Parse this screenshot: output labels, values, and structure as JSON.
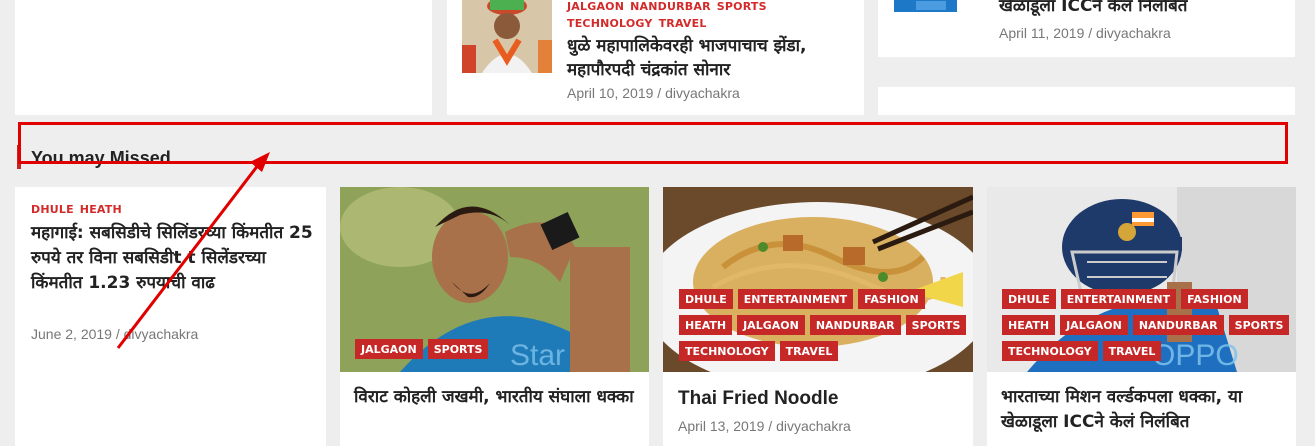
{
  "top": {
    "card_middle": {
      "categories": [
        "JALGAON",
        "NANDURBAR",
        "SPORTS",
        "TECHNOLOGY",
        "TRAVEL"
      ],
      "title": "धुळे महापालिकेवरही भाजपाचाच झेंडा, महापौरपदी चंद्रकांत सोनार",
      "date": "April 10, 2019",
      "sep": "/",
      "author": "divyachakra"
    },
    "card_right": {
      "title": "खेळाडूला ICCने केलं निलंबित",
      "date": "April 11, 2019",
      "sep": "/",
      "author": "divyachakra"
    }
  },
  "section": {
    "title": "You may Missed"
  },
  "missed": [
    {
      "categories": [
        "DHULE",
        "HEATH"
      ],
      "title": "महागाई: सबसिडीचे सिलिंडरच्या किंमतीत 25 रुपये तर विना सबसिडीt t सिलेंडरच्या किंमतीत 1.23 रुपयाची वाढ",
      "date": "June 2, 2019",
      "sep": "/",
      "author": "divyachakra"
    },
    {
      "badges": [
        "JALGAON",
        "SPORTS"
      ],
      "title": "विराट कोहली जखमी, भारतीय संघाला धक्का"
    },
    {
      "badges": [
        "DHULE",
        "ENTERTAINMENT",
        "FASHION",
        "HEATH",
        "JALGAON",
        "NANDURBAR",
        "SPORTS",
        "TECHNOLOGY",
        "TRAVEL"
      ],
      "title": "Thai Fried Noodle",
      "date": "April 13, 2019",
      "sep": "/",
      "author": "divyachakra"
    },
    {
      "badges": [
        "DHULE",
        "ENTERTAINMENT",
        "FASHION",
        "HEATH",
        "JALGAON",
        "NANDURBAR",
        "SPORTS",
        "TECHNOLOGY",
        "TRAVEL"
      ],
      "title": "भारताच्या मिशन वर्ल्डकपला धक्का, या खेळाडूला ICCने केलं निलंबित"
    }
  ],
  "colors": {
    "accent": "#c62828",
    "annotation": "#e00000"
  }
}
